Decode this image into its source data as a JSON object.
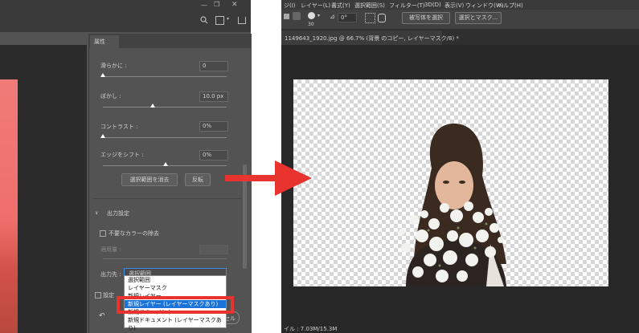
{
  "left_panel": {
    "panel_tab": "属性",
    "smooth": {
      "label": "滑らかに :",
      "value": "0",
      "level": 0.0
    },
    "feather": {
      "label": "ぼかし :",
      "value": "10.0 px",
      "level": 0.45
    },
    "contrast": {
      "label": "コントラスト :",
      "value": "0%",
      "level": 0.0
    },
    "shift_edge": {
      "label": "エッジをシフト :",
      "value": "0%",
      "level": 0.5
    },
    "clear_selection_button": "選択範囲を消去",
    "invert_button": "反転",
    "output_section_title": "出力設定",
    "decontaminate_checkbox_label": "不要なカラーの除去",
    "amount_label": "適用量 :",
    "output_to_label": "出力先 :",
    "output_to_value": "選択範囲",
    "remember_checkbox_label": "設定",
    "cancel_fragment": "セル",
    "output_options": [
      {
        "label": "選択範囲",
        "selected": false
      },
      {
        "label": "レイヤーマスク",
        "selected": false
      },
      {
        "label": "新規レイヤー",
        "selected": false
      },
      {
        "label": "新規レイヤー (レイヤーマスクあり)",
        "selected": true
      },
      {
        "label": "新規ドキュメント",
        "selected": false
      },
      {
        "label": "新規ドキュメント (レイヤーマスクあり)",
        "selected": false
      }
    ]
  },
  "right_window": {
    "menu": [
      "ジ(I)",
      "レイヤー(L)",
      "書式(Y)",
      "選択範囲(S)",
      "フィルター(T)",
      "3D(D)",
      "表示(V)",
      "ウィンドウ(W)",
      "ヘルプ(H)"
    ],
    "brush_size": "30",
    "angle_value": "0°",
    "select_subject_button": "被写体を選択",
    "select_mask_button": "選択とマスク...",
    "document_tab": "1149643_1920.jpg @ 66.7% (背景 のコピー, レイヤーマスク/8) *",
    "status": "イル : 7.03M/15.3M"
  },
  "colors": {
    "highlight": "#e8332e",
    "selected_item": "#1a73d9",
    "panel_bg": "#535353"
  }
}
